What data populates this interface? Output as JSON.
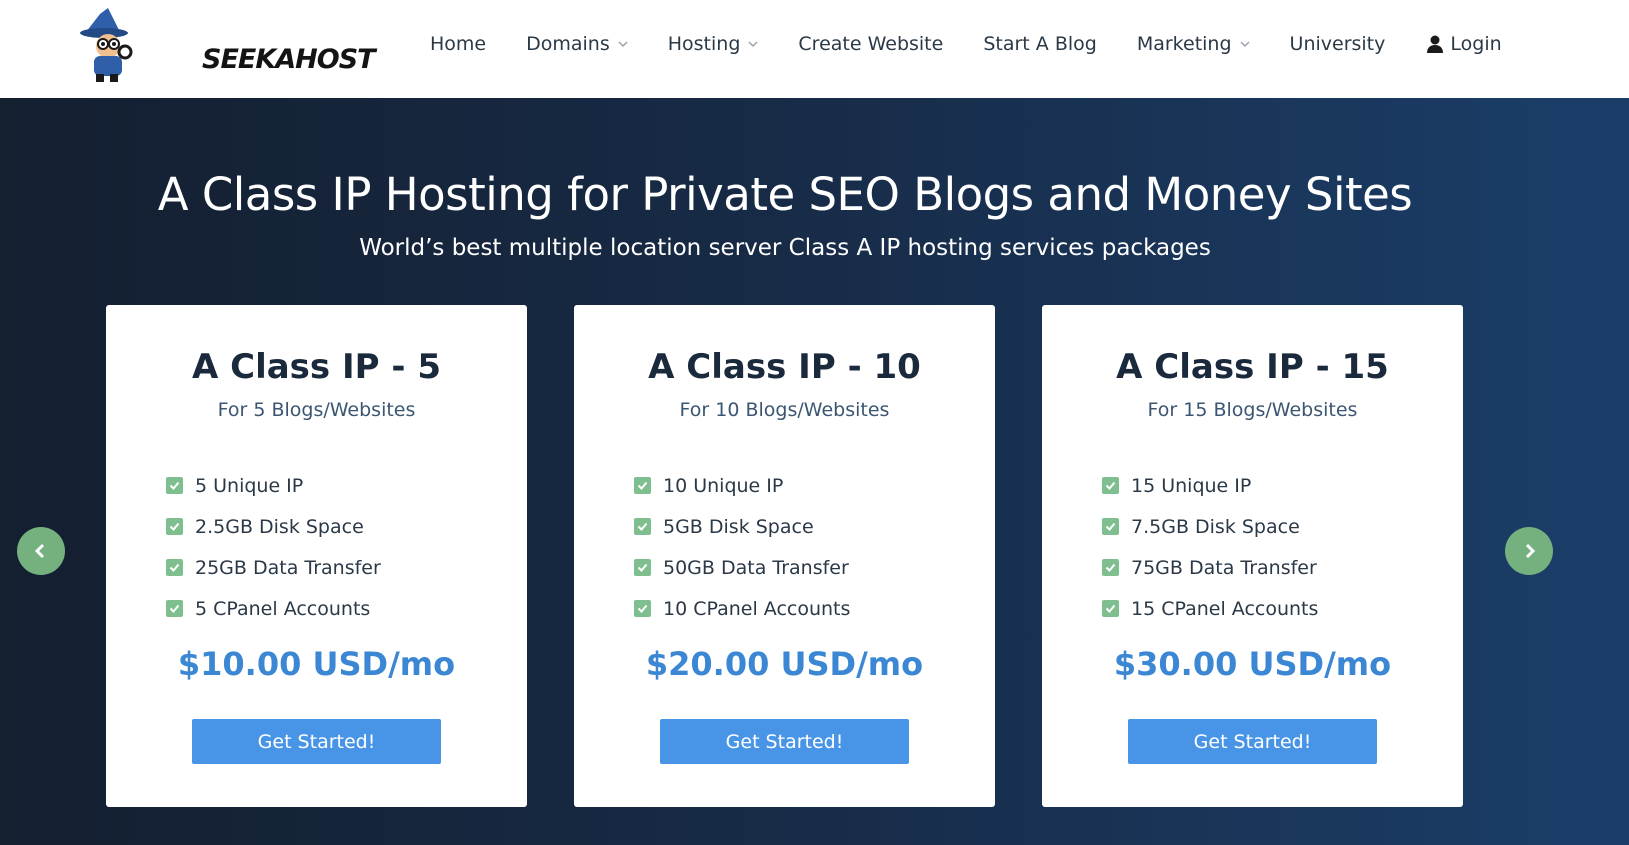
{
  "brand": {
    "logo_text": "SEEKAHOST"
  },
  "nav": {
    "items": [
      {
        "label": "Home",
        "dropdown": false
      },
      {
        "label": "Domains",
        "dropdown": true
      },
      {
        "label": "Hosting",
        "dropdown": true
      },
      {
        "label": "Create Website",
        "dropdown": false
      },
      {
        "label": "Start A Blog",
        "dropdown": false
      },
      {
        "label": "Marketing",
        "dropdown": true
      },
      {
        "label": "University",
        "dropdown": false
      }
    ],
    "login": {
      "label": "Login",
      "icon": "user-icon"
    }
  },
  "hero": {
    "title": "A Class IP Hosting for Private SEO Blogs and Money Sites",
    "subtitle": "World’s best multiple location server Class A IP hosting services packages"
  },
  "plans": [
    {
      "title": "A Class IP - 5",
      "subtitle": "For 5 Blogs/Websites",
      "features": [
        "5 Unique IP",
        "2.5GB Disk Space",
        "25GB Data Transfer",
        "5 CPanel Accounts"
      ],
      "price": "$10.00 USD/mo",
      "cta": "Get Started!"
    },
    {
      "title": "A Class IP - 10",
      "subtitle": "For 10 Blogs/Websites",
      "features": [
        "10 Unique IP",
        "5GB Disk Space",
        "50GB Data Transfer",
        "10 CPanel Accounts"
      ],
      "price": "$20.00 USD/mo",
      "cta": "Get Started!"
    },
    {
      "title": "A Class IP - 15",
      "subtitle": "For 15 Blogs/Websites",
      "features": [
        "15 Unique IP",
        "7.5GB Disk Space",
        "75GB Data Transfer",
        "15 CPanel Accounts"
      ],
      "price": "$30.00 USD/mo",
      "cta": "Get Started!"
    }
  ],
  "carousel": {
    "prev_icon": "chevron-left-icon",
    "next_icon": "chevron-right-icon"
  },
  "colors": {
    "hero_gradient_start": "#141f30",
    "hero_gradient_end": "#1b3e69",
    "price": "#3b87d4",
    "cta_bg": "#4895e8",
    "check": "#7fbf8f",
    "arrow": "#74b17f"
  }
}
